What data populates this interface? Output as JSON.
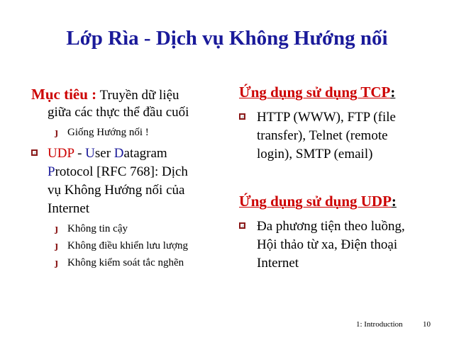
{
  "slide": {
    "title": "Lớp Rìa - Dịch vụ Không Hướng nối",
    "left": {
      "goal_label": "Mục tiêu :",
      "goal_text_1": " Truyền dữ liệu",
      "goal_text_2": "giữa các thực thể đầu cuối",
      "goal_sub": "Giống Hướng nối !",
      "udp_prefix_1": "UDP",
      "udp_dash": " - ",
      "udp_U": "U",
      "udp_ser": "ser ",
      "udp_D": "D",
      "udp_atagram": "atagram",
      "udp_P": "P",
      "udp_line2_rest": "rotocol [RFC 768]: Dịch",
      "udp_line3": "vụ Không Hướng nối của",
      "udp_line4": "Internet",
      "udp_subs": [
        "Không tin cậy",
        "Không điều khiển lưu lượng",
        "Không kiểm soát tắc nghẽn"
      ]
    },
    "right": {
      "tcp_heading": "Ứng dụng sử dụng TCP",
      "tcp_colon": ":",
      "tcp_lines": [
        "HTTP (WWW), FTP (file",
        "transfer), Telnet (remote",
        "login), SMTP (email)"
      ],
      "udp_heading": "Ứng dụng sử dụng UDP",
      "udp_colon": ":",
      "udp_lines": [
        "Đa phương tiện theo luồng,",
        "Hội thảo từ xa, Điện thoại",
        "Internet"
      ]
    },
    "footer": {
      "chapter": "1: Introduction",
      "page": "10"
    },
    "colors": {
      "title": "#1a1a9a",
      "accent_red": "#cc0000",
      "bullet": "#8b1a1a"
    }
  }
}
